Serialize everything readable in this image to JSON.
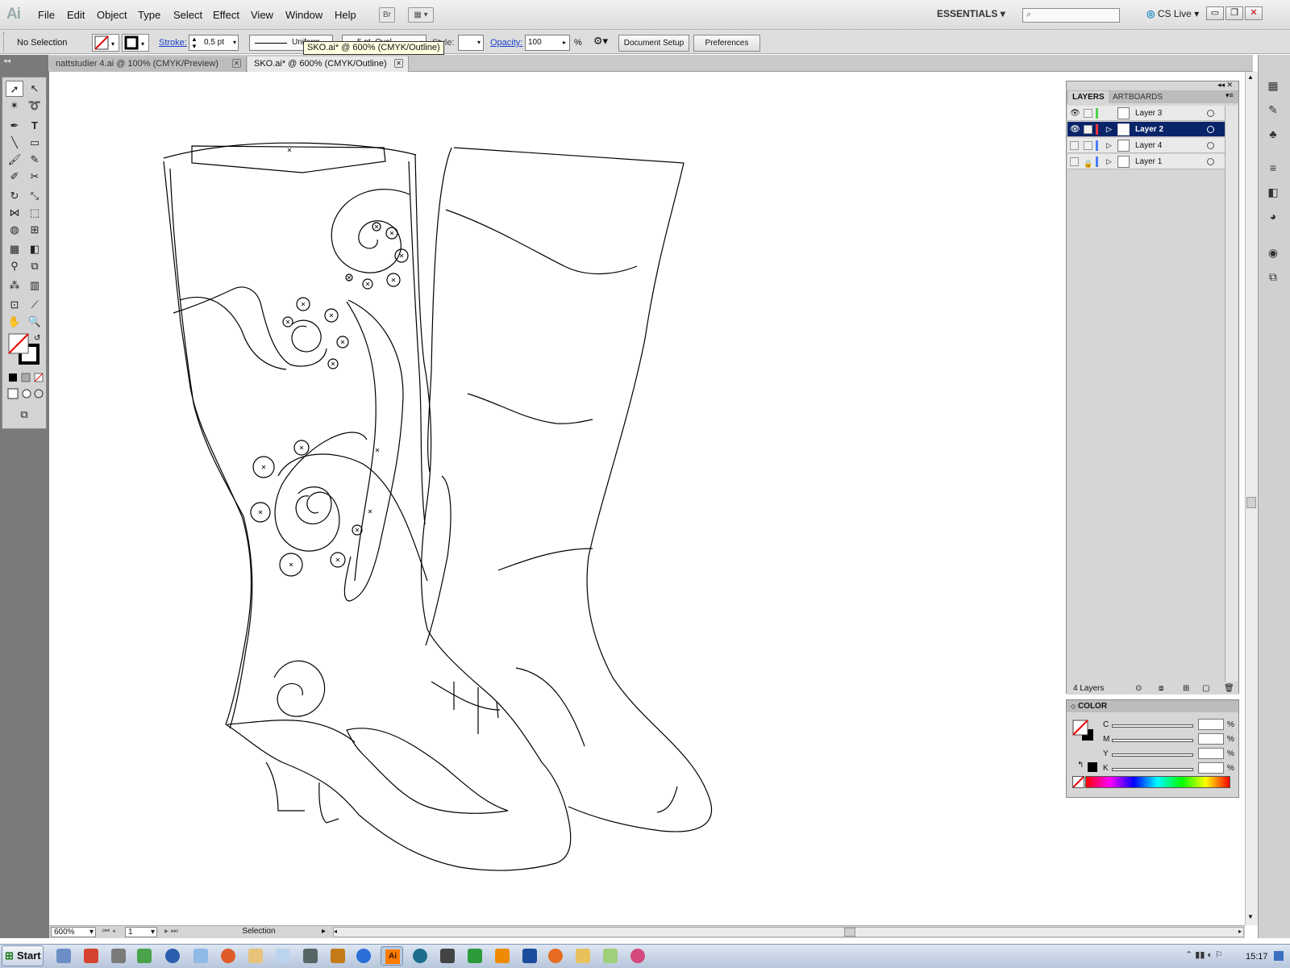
{
  "app": {
    "logo": "Ai"
  },
  "menu": [
    "File",
    "Edit",
    "Object",
    "Type",
    "Select",
    "Effect",
    "View",
    "Window",
    "Help"
  ],
  "topbar": {
    "bridge": "Br",
    "workspace": "ESSENTIALS",
    "cslive": "CS Live"
  },
  "control": {
    "selection": "No Selection",
    "stroke_label": "Stroke:",
    "stroke_value": "0,5 pt",
    "profile": "Uniform",
    "brush": "5 pt. Oval",
    "style_label": "Style:",
    "opacity_label": "Opacity:",
    "opacity_value": "100",
    "opacity_unit": "%",
    "doc_setup": "Document Setup",
    "preferences": "Preferences"
  },
  "tooltip": "SKO.ai* @ 600% (CMYK/Outline)",
  "tabs": [
    {
      "label": "nattstudier 4.ai @ 100% (CMYK/Preview)"
    },
    {
      "label": "SKO.ai* @ 600% (CMYK/Outline)"
    }
  ],
  "layers_panel": {
    "tabs": [
      "LAYERS",
      "ARTBOARDS"
    ],
    "layers": [
      {
        "name": "Layer 3",
        "color": "#4cd24c"
      },
      {
        "name": "Layer 2",
        "color": "#ff3a3a"
      },
      {
        "name": "Layer 4",
        "color": "#4a7cff"
      },
      {
        "name": "Layer 1",
        "color": "#4a7cff"
      }
    ],
    "count": "4 Layers"
  },
  "color_panel": {
    "title": "COLOR",
    "channels": [
      "C",
      "M",
      "Y",
      "K"
    ],
    "unit": "%"
  },
  "status": {
    "zoom": "600%",
    "page": "1",
    "mode": "Selection"
  },
  "taskbar": {
    "start": "Start",
    "time": "15:17"
  }
}
